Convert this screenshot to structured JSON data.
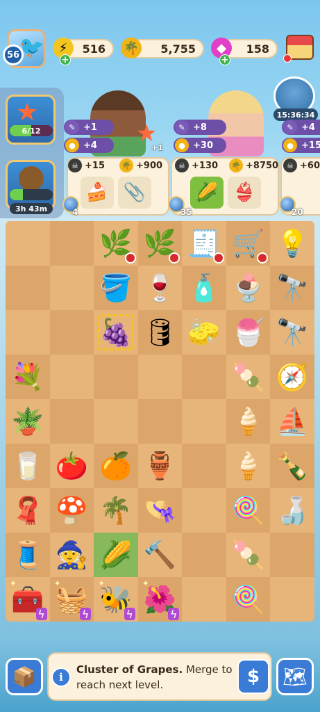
{
  "player": {
    "level": "56",
    "avatar_icon": "seagull-icon"
  },
  "resources": {
    "energy": {
      "value": "516",
      "icon": "energy-bolt-icon",
      "color": "#f2c521"
    },
    "coins": {
      "value": "5,755",
      "icon": "palm-coin-icon",
      "color": "#f2b415"
    },
    "gems": {
      "value": "158",
      "icon": "gem-icon",
      "color": "#e23fc7"
    }
  },
  "shop": {
    "icon": "market-stall-icon"
  },
  "event_timer": {
    "text": "15:36:34"
  },
  "left_events": [
    {
      "progress_text": "6/12",
      "progress": 0.5,
      "icon": "starfish-icon"
    },
    {
      "progress_text": "3h 43m",
      "progress": 0.3,
      "icon": "acorn-pouch-icon"
    }
  ],
  "orders": [
    {
      "character": "man-customer",
      "bonus_star": "+1",
      "pills": [
        "+1",
        "+4"
      ],
      "rewards": {
        "xp": "+15",
        "coins": "+900"
      },
      "items": [
        "cake-icon",
        "safety-pin-icon"
      ],
      "globe_count": "4"
    },
    {
      "character": "woman-customer",
      "pills": [
        "+8",
        "+30"
      ],
      "rewards": {
        "xp": "+130",
        "coins": "+8750"
      },
      "items": [
        "corn-icon",
        "bikini-icon"
      ],
      "globe_count": "35"
    },
    {
      "character": "partial-customer",
      "pills": [
        "+4",
        "+15"
      ],
      "rewards": {
        "xp": "+60"
      },
      "globe_count": "20"
    }
  ],
  "board": [
    [
      "",
      "",
      "vines-locked",
      "vines-locked",
      "cash-register-locked",
      "ice-cream-cart-locked",
      "light-bulb"
    ],
    [
      "",
      "",
      "grape-barrel",
      "wine-bottle",
      "soap-dispenser",
      "ice-cream-sundae",
      "telescope"
    ],
    [
      "",
      "",
      "grapes-selected",
      "wine-press",
      "sea-sponge",
      "ice-cream-cup",
      "spyglass"
    ],
    [
      "flowers",
      "",
      "",
      "",
      "",
      "sorbet-scoops",
      "compass"
    ],
    [
      "potted-plant",
      "",
      "",
      "",
      "",
      "ice-cream-cone",
      "sailing-ship"
    ],
    [
      "thimble",
      "tomatoes",
      "pin-cushion",
      "flower-pot",
      "",
      "vanilla-cone",
      "ship-in-bottle"
    ],
    [
      "bandana",
      "mushroom-house",
      "bonsai",
      "green-hat",
      "",
      "popsicle",
      "bottle-small"
    ],
    [
      "needle-thread",
      "gnome",
      "corn-highlight",
      "trowel",
      "",
      "green-popsicle",
      ""
    ],
    [
      "sewing-station",
      "veggie-crate",
      "beehive",
      "flower-stand",
      "",
      "red-popsicle",
      ""
    ]
  ],
  "info": {
    "item_name": "Cluster of Grapes.",
    "description": "Merge to reach next level."
  },
  "buttons": {
    "sell_label": "$"
  }
}
